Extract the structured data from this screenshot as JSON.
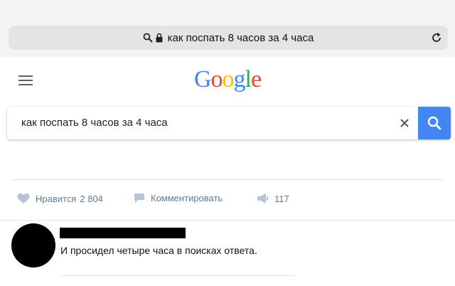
{
  "browser": {
    "address_text": "как поспать 8 часов за 4 часа",
    "icons": [
      "search-icon",
      "lock-icon",
      "reload-icon"
    ]
  },
  "google": {
    "logo_letters": [
      {
        "char": "G",
        "color": "#4285F4"
      },
      {
        "char": "o",
        "color": "#EA4335"
      },
      {
        "char": "o",
        "color": "#FBBC05"
      },
      {
        "char": "g",
        "color": "#4285F4"
      },
      {
        "char": "l",
        "color": "#34A853"
      },
      {
        "char": "e",
        "color": "#EA4335"
      }
    ],
    "search_query": "как поспать 8 часов за 4 часа",
    "search_button_color": "#4285F4"
  },
  "post_actions": {
    "like_label": "Нравится",
    "like_count": "2 804",
    "comment_label": "Комментировать",
    "share_count": "117"
  },
  "comment": {
    "text": "И просидел четыре часа в поисках ответа."
  }
}
